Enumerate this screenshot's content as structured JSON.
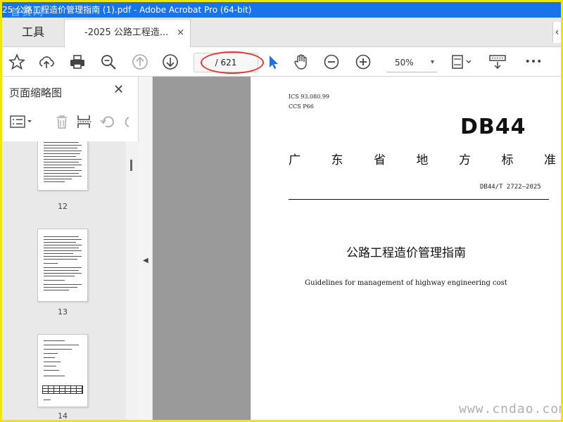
{
  "window": {
    "title": "25 公路工程造价管理指南 (1).pdf - Adobe Acrobat Pro (64-bit)",
    "watermark": "首赞网"
  },
  "tabs": {
    "tools_label": "工具",
    "doc_label": "-2025 公路工程造...",
    "close_glyph": "×",
    "scroll_glyph": "‹"
  },
  "toolbar": {
    "page_indicator": "/ 621",
    "zoom": "50%",
    "zoom_caret": "▾",
    "icons": [
      "bookmark-star-icon",
      "upload-cloud-icon",
      "print-icon",
      "search-zoom-icon",
      "page-up-icon",
      "page-down-icon",
      "select-pointer-icon",
      "hand-icon",
      "zoom-out-icon",
      "zoom-in-icon",
      "page-fit-icon",
      "scroll-mode-icon",
      "more-icon"
    ],
    "more_glyph": "•••"
  },
  "sidepanel": {
    "title": "页面缩略图",
    "close_glyph": "✕",
    "thumbnails": [
      {
        "label": "12"
      },
      {
        "label": "13"
      },
      {
        "label": "14"
      }
    ]
  },
  "collapse_glyph": "◀",
  "document": {
    "ics": "ICS  93.080.99",
    "ccs": "CCS  P66",
    "standard_mark": "DB44",
    "province": [
      "广",
      "东",
      "省",
      "地",
      "方",
      "标",
      "准"
    ],
    "standard_no": "DB44/T  2722—2025",
    "title_cn": "公路工程造价管理指南",
    "title_en": "Guidelines for management of highway engineering cost",
    "site_watermark": "www.cndao.com"
  },
  "colors": {
    "title_bar": "#1a73e8",
    "border_frame": "#f2e600",
    "highlight": "#e53935",
    "pointer": "#1a73e8"
  }
}
